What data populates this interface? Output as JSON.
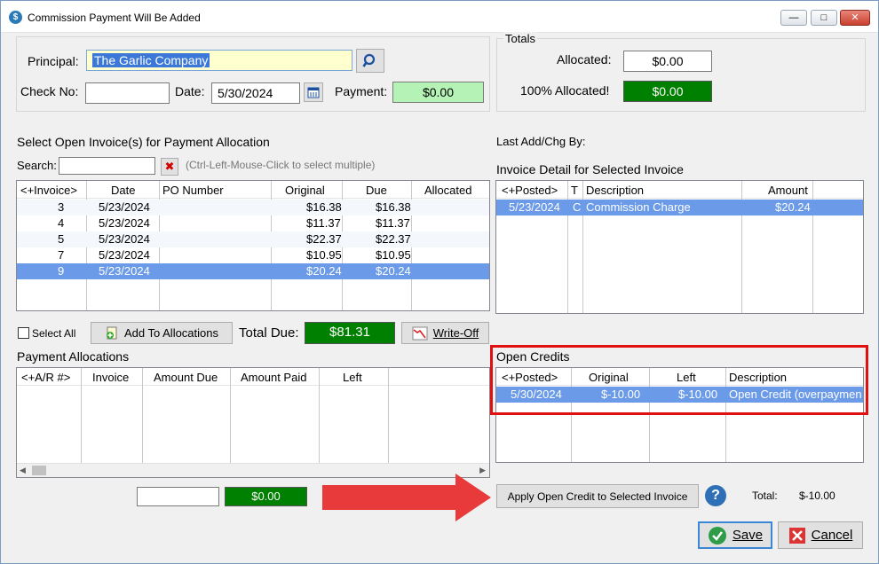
{
  "window": {
    "title": "Commission Payment Will Be Added"
  },
  "principal": {
    "label": "Principal:",
    "value": "The Garlic Company"
  },
  "check": {
    "label": "Check No:",
    "value": ""
  },
  "date": {
    "label": "Date:",
    "value": "5/30/2024"
  },
  "payment": {
    "label": "Payment:",
    "value": "$0.00"
  },
  "totals": {
    "group_label": "Totals",
    "allocated_label": "Allocated:",
    "allocated_value": "$0.00",
    "full_label": "100% Allocated!",
    "full_value": "$0.00"
  },
  "last_add": {
    "label": "Last Add/Chg By:"
  },
  "invoices": {
    "section_title": "Select Open Invoice(s) for Payment Allocation",
    "search_label": "Search:",
    "search_hint": "(Ctrl-Left-Mouse-Click to select multiple)",
    "columns": [
      "<+Invoice>",
      "Date",
      "PO Number",
      "Original",
      "Due",
      "Allocated"
    ],
    "rows": [
      {
        "invoice": "3",
        "date": "5/23/2024",
        "po": "",
        "original": "$16.38",
        "due": "$16.38",
        "allocated": ""
      },
      {
        "invoice": "4",
        "date": "5/23/2024",
        "po": "",
        "original": "$11.37",
        "due": "$11.37",
        "allocated": ""
      },
      {
        "invoice": "5",
        "date": "5/23/2024",
        "po": "",
        "original": "$22.37",
        "due": "$22.37",
        "allocated": ""
      },
      {
        "invoice": "7",
        "date": "5/23/2024",
        "po": "",
        "original": "$10.95",
        "due": "$10.95",
        "allocated": ""
      },
      {
        "invoice": "9",
        "date": "5/23/2024",
        "po": "",
        "original": "$20.24",
        "due": "$20.24",
        "allocated": ""
      }
    ]
  },
  "detail": {
    "section_title": "Invoice Detail for Selected Invoice",
    "columns": [
      "<+Posted>",
      "T",
      "Description",
      "Amount"
    ],
    "rows": [
      {
        "posted": "5/23/2024",
        "t": "C",
        "description": "Commission Charge",
        "amount": "$20.24"
      }
    ]
  },
  "select_all": {
    "label": "Select All"
  },
  "add_alloc": {
    "label": "Add To Allocations"
  },
  "total_due": {
    "label": "Total Due:",
    "value": "$81.31"
  },
  "writeoff": {
    "label": "Write-Off"
  },
  "allocations": {
    "section_title": "Payment Allocations",
    "columns": [
      "<+A/R #>",
      "Invoice",
      "Amount Due",
      "Amount Paid",
      "Left"
    ],
    "footer_input": "",
    "footer_total": "$0.00"
  },
  "credits": {
    "section_title": "Open Credits",
    "columns": [
      "<+Posted>",
      "Original",
      "Left",
      "Description"
    ],
    "rows": [
      {
        "posted": "5/30/2024",
        "original": "$-10.00",
        "left": "$-10.00",
        "description": "Open Credit (overpaymen"
      }
    ]
  },
  "apply_credit": {
    "label": "Apply Open Credit to Selected Invoice"
  },
  "credit_total": {
    "label": "Total:",
    "value": "$-10.00"
  },
  "save": {
    "label": "Save"
  },
  "cancel": {
    "label": "Cancel"
  },
  "colors": {
    "accent_green": "#008000",
    "selection": "#6b9ae8",
    "highlight_red": "#e01010",
    "arrow_red": "#e83a3a"
  }
}
